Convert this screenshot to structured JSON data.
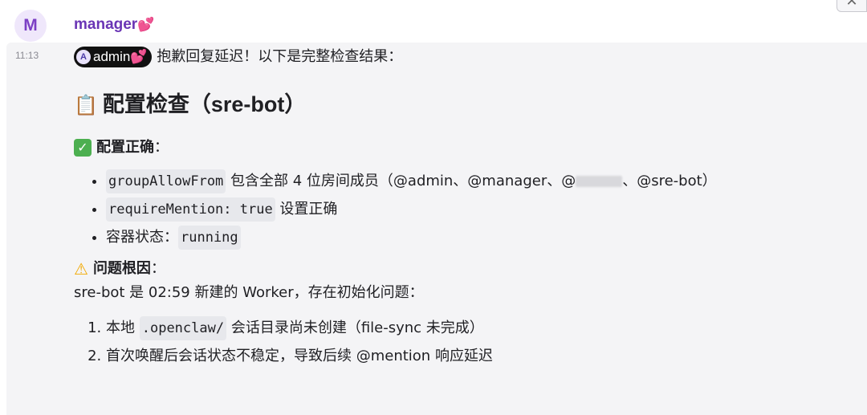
{
  "sender": {
    "avatar_letter": "M",
    "name": "manager",
    "emoji": "💕"
  },
  "close_symbol": "✕",
  "message": {
    "time": "11:13",
    "mention": {
      "badge": "A",
      "name": "admin",
      "emoji": "💕"
    },
    "intro": "抱歉回复延迟！以下是完整检查结果：",
    "heading_icon": "📋",
    "heading": "配置检查（sre-bot）",
    "ok_icon": "✅",
    "ok_title": "配置正确",
    "ok_colon": "：",
    "ok_items": [
      {
        "code": "groupAllowFrom",
        "text": " 包含全部 4 位房间成员（@admin、@manager、@",
        "text2": "、@sre-bot）"
      },
      {
        "code": "requireMention: true",
        "text": " 设置正确"
      },
      {
        "prefix": "容器状态：",
        "code": "running"
      }
    ],
    "warn_icon": "⚠️",
    "warn_title": "问题根因",
    "warn_colon": "：",
    "cause": "sre-bot 是 02:59 新建的 Worker，存在初始化问题：",
    "steps": [
      {
        "prefix": "本地 ",
        "code": ".openclaw/",
        "text": " 会话目录尚未创建（file-sync 未完成）"
      },
      {
        "text": "首次唤醒后会话状态不稳定，导致后续 @mention 响应延迟"
      }
    ]
  }
}
